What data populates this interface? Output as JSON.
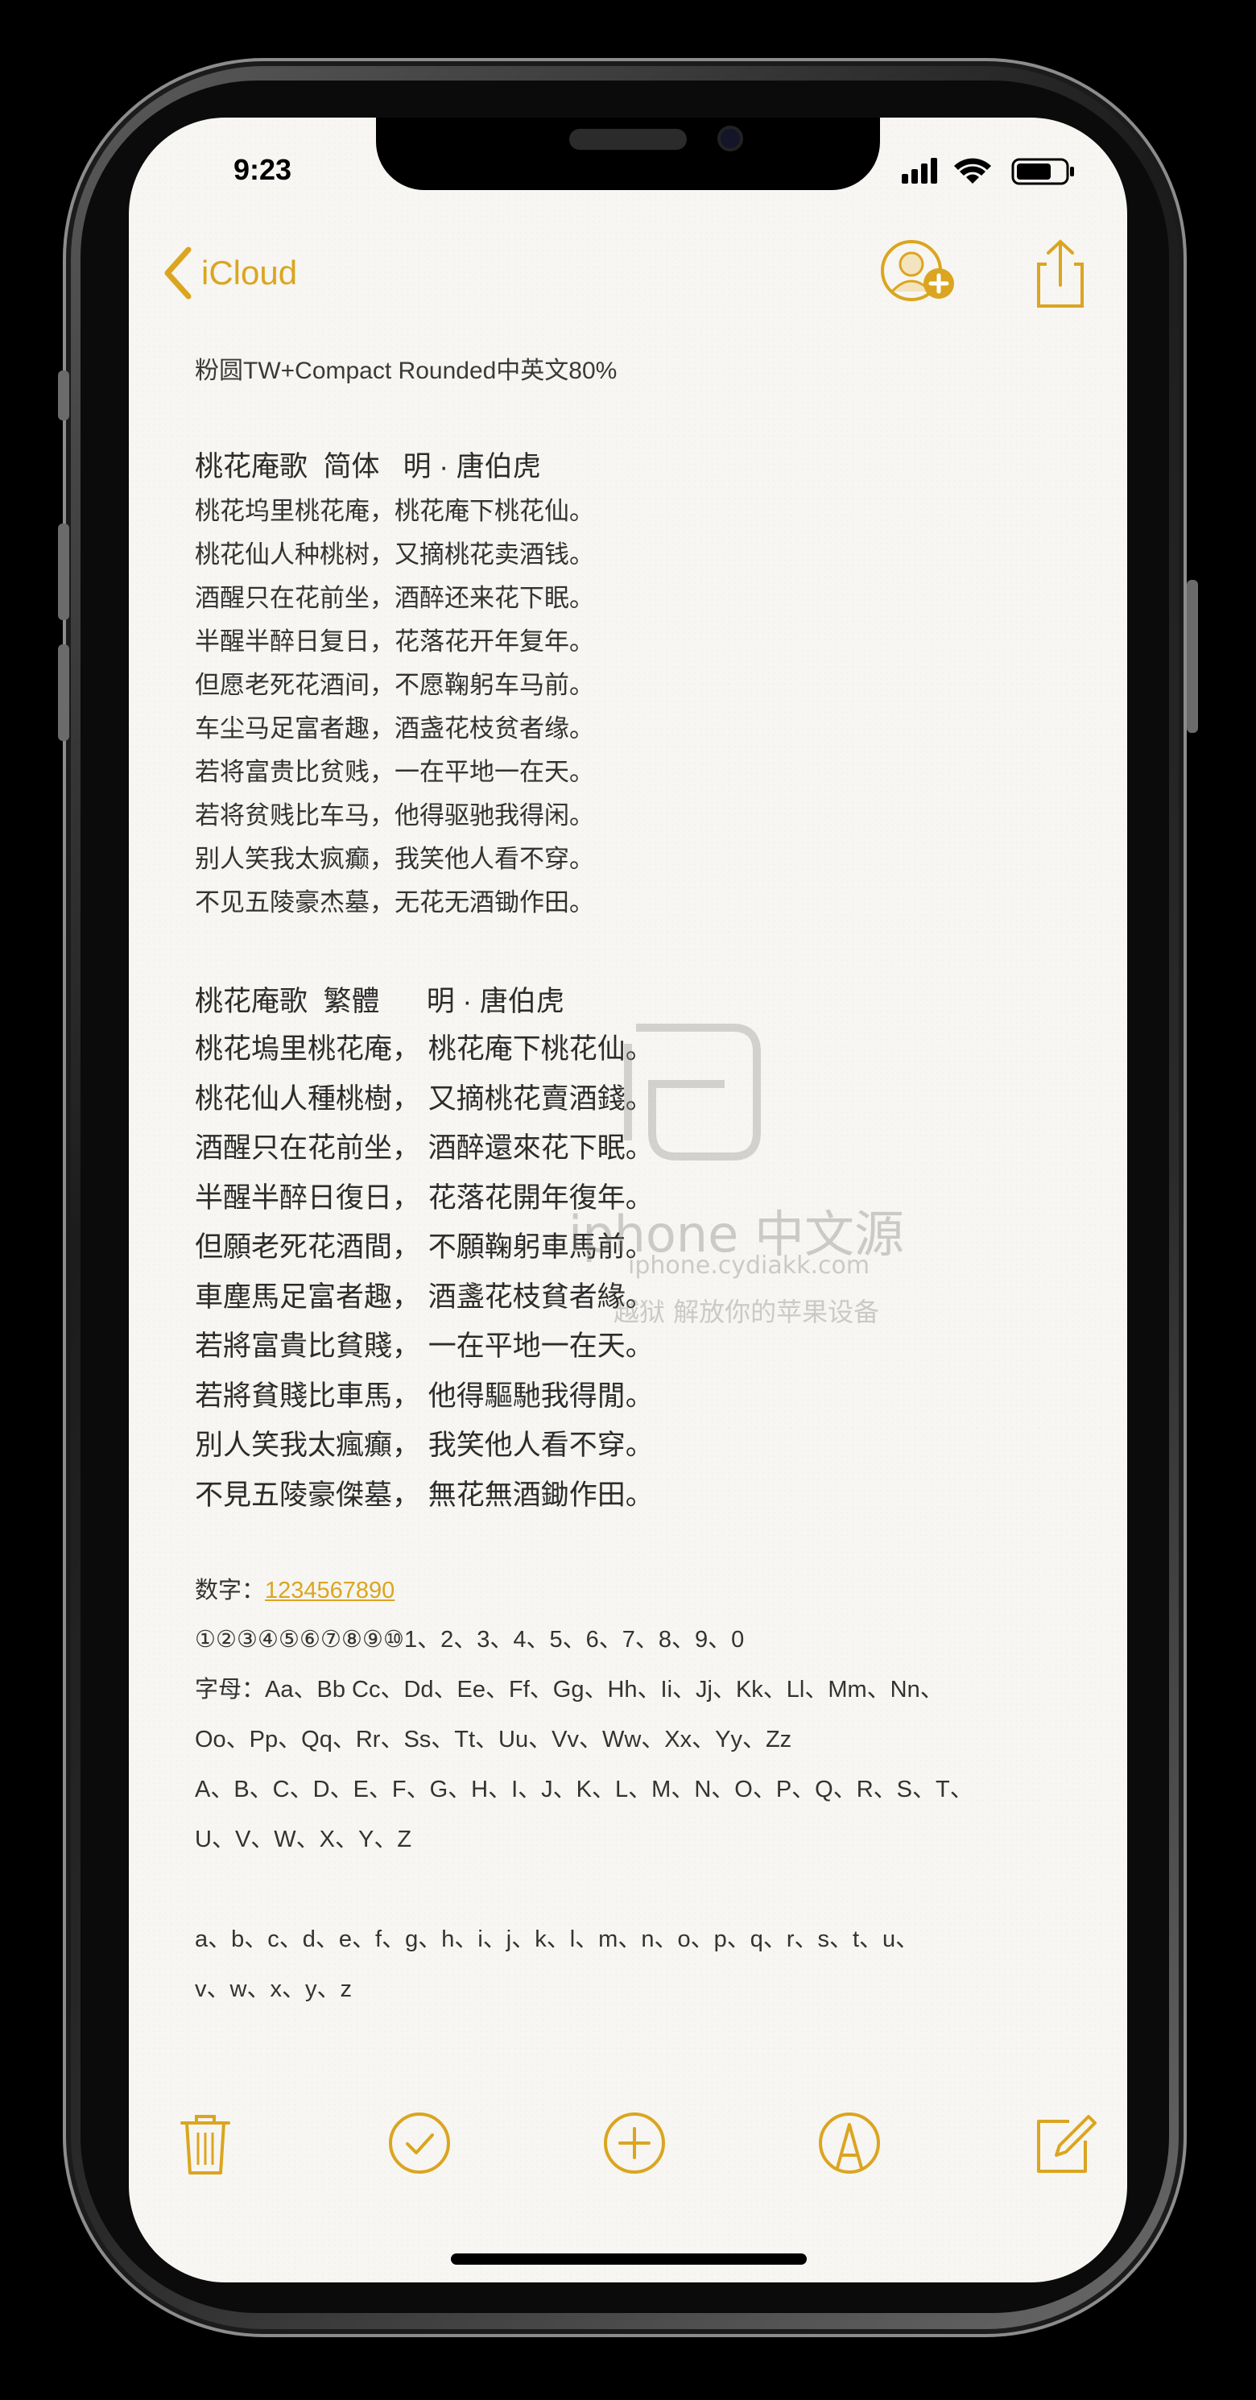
{
  "status_bar": {
    "time": "9:23"
  },
  "nav": {
    "back_label": "iCloud"
  },
  "icons": {
    "back": "chevron-left-icon",
    "share": "add-person-icon",
    "export": "share-icon",
    "trash": "trash-icon",
    "checklist": "checkmark-circle-icon",
    "add": "plus-circle-icon",
    "markup": "pen-circle-icon",
    "compose": "compose-icon"
  },
  "colors": {
    "accent": "#dba520",
    "text": "#333333",
    "paper": "#f7f6f2"
  },
  "note": {
    "font_caption": "粉圆TW+Compact Rounded中英文80%",
    "simplified": {
      "title": "桃花庵歌  简体   明 · 唐伯虎",
      "lines": [
        "桃花坞里桃花庵，桃花庵下桃花仙。",
        "桃花仙人种桃树，又摘桃花卖酒钱。",
        "酒醒只在花前坐，酒醉还来花下眠。",
        "半醒半醉日复日，花落花开年复年。",
        "但愿老死花酒间，不愿鞠躬车马前。",
        "车尘马足富者趣，酒盏花枝贫者缘。",
        "若将富贵比贫贱，一在平地一在天。",
        "若将贫贱比车马，他得驱驰我得闲。",
        "别人笑我太疯癫，我笑他人看不穿。",
        "不见五陵豪杰墓，无花无酒锄作田。"
      ]
    },
    "traditional": {
      "title": "桃花庵歌  繁體      明 · 唐伯虎",
      "lines": [
        "桃花塢里桃花庵，  桃花庵下桃花仙。",
        "桃花仙人種桃樹，  又摘桃花賣酒錢。",
        "酒醒只在花前坐，  酒醉還來花下眠。",
        "半醒半醉日復日，  花落花開年復年。",
        "但願老死花酒間，  不願鞠躬車馬前。",
        "車塵馬足富者趣，  酒盞花枝貧者緣。",
        "若將富貴比貧賤，  一在平地一在天。",
        "若將貧賤比車馬，  他得驅馳我得閒。",
        "別人笑我太瘋癲，  我笑他人看不穿。",
        "不見五陵豪傑墓，  無花無酒鋤作田。"
      ]
    },
    "digits_label": "数字：",
    "digits_value": "1234567890",
    "circled_digits": "①②③④⑤⑥⑦⑧⑨⑩1、2、3、4、5、6、7、8、9、0",
    "letters_row1": "字母：Aa、Bb Cc、Dd、Ee、Ff、Gg、Hh、Ii、Jj、Kk、Ll、Mm、Nn、",
    "letters_row2": "Oo、Pp、Qq、Rr、Ss、Tt、Uu、Vv、Ww、Xx、Yy、Zz",
    "upper_row1": "A、B、C、D、E、F、G、H、I、J、K、L、M、N、O、P、Q、R、S、T、",
    "upper_row2": "U、V、W、X、Y、Z",
    "lower_row1": "a、b、c、d、e、f、g、h、i、j、k、l、m、n、o、p、q、r、s、t、u、",
    "lower_row2": "v、w、x、y、z"
  },
  "watermark": {
    "line1": "iphone 中文源",
    "line2": "iphone.cydiakk.com",
    "line3": "越狱 解放你的苹果设备"
  }
}
